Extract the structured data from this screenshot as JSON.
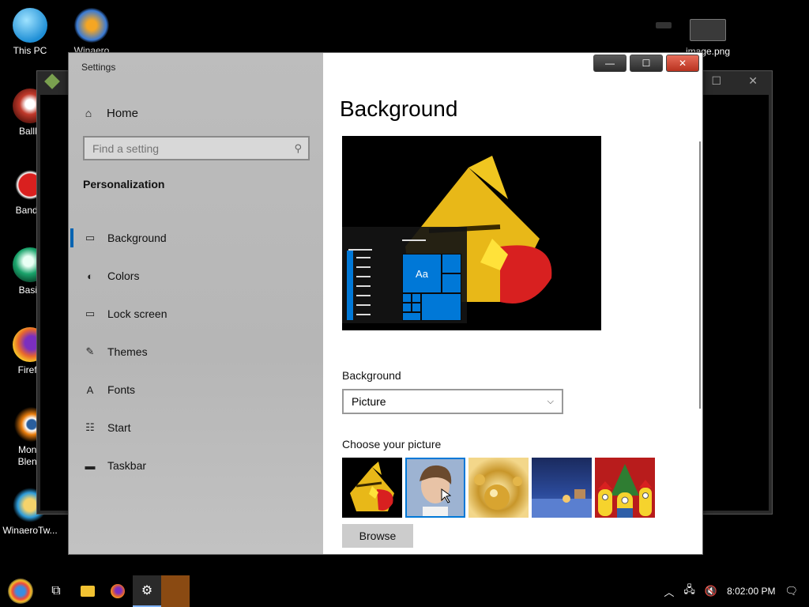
{
  "desktop": {
    "icons": [
      {
        "label": "This PC",
        "color": "#36a6e8"
      },
      {
        "label": "Winaero",
        "color": "#3a7bd5"
      },
      {
        "label": "BallB",
        "color": "#c0392b"
      },
      {
        "label": "Bandic",
        "color": "#d9201f"
      },
      {
        "label": "Basili",
        "color": "#1aa36b"
      },
      {
        "label": "Firefo",
        "color": "#e8672c"
      },
      {
        "label": "Mono\nBlend",
        "color": "#e87d0d"
      },
      {
        "label": "WinaeroTw...",
        "color": "#2d9cdb"
      },
      {
        "label": "image.png",
        "color": "#555555"
      }
    ]
  },
  "window": {
    "title": "Settings",
    "caption": {
      "minimize": "—",
      "maximize": "☐",
      "close": "✕"
    }
  },
  "sidebar": {
    "home_label": "Home",
    "search_placeholder": "Find a setting",
    "section_title": "Personalization",
    "items": [
      {
        "label": "Background",
        "icon": "image-icon",
        "glyph": "▭"
      },
      {
        "label": "Colors",
        "icon": "palette-icon",
        "glyph": "◐"
      },
      {
        "label": "Lock screen",
        "icon": "lock-screen-icon",
        "glyph": "▭"
      },
      {
        "label": "Themes",
        "icon": "themes-icon",
        "glyph": "✎"
      },
      {
        "label": "Fonts",
        "icon": "fonts-icon",
        "glyph": "A"
      },
      {
        "label": "Start",
        "icon": "start-icon",
        "glyph": "☷"
      },
      {
        "label": "Taskbar",
        "icon": "taskbar-icon",
        "glyph": "▬"
      }
    ],
    "active_index": 0
  },
  "main": {
    "page_title": "Background",
    "preview_tile_text": "Aa",
    "background_label": "Background",
    "background_value": "Picture",
    "choose_label": "Choose your picture",
    "thumbnails": [
      {
        "name": "angry-bird",
        "selected": false
      },
      {
        "name": "portrait",
        "selected": true
      },
      {
        "name": "golden-ornaments",
        "selected": false
      },
      {
        "name": "night-scene",
        "selected": false
      },
      {
        "name": "minions-christmas",
        "selected": false
      }
    ],
    "browse_label": "Browse"
  },
  "taskbar": {
    "clock": "8:02:00 PM",
    "accent": "#7fb3ff"
  }
}
